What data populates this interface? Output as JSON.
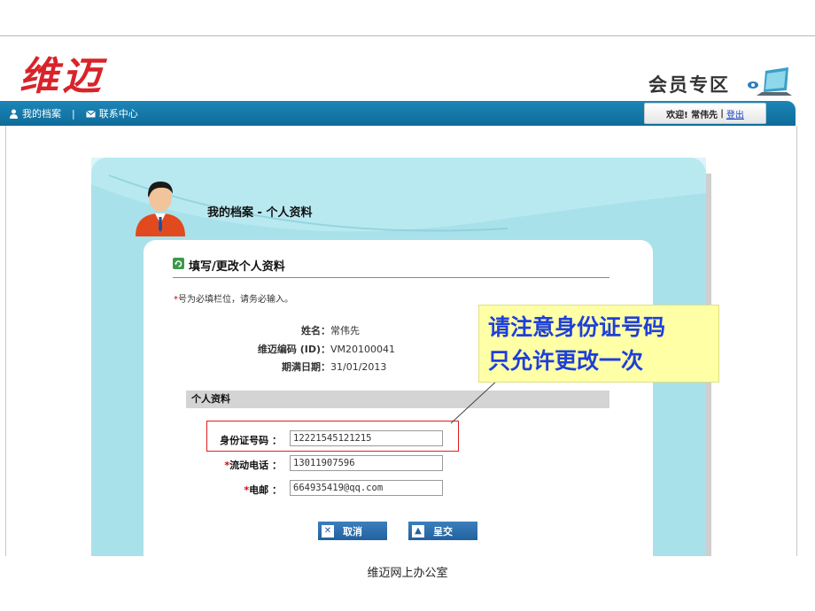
{
  "brand": "维迈",
  "member_zone": "会员专区",
  "nav": {
    "my_profile": "我的档案",
    "separator": "|",
    "contact": "联系中心"
  },
  "welcome": {
    "text": "欢迎! 常伟先",
    "separator": "|",
    "logout": "登出"
  },
  "panel": {
    "title": "我的档案 - 个人资料",
    "form_title": "填写/更改个人资料",
    "required_note_star": "*",
    "required_note": "号为必填栏位，请务必输入。"
  },
  "info": [
    {
      "label": "姓名：",
      "value": "常伟先"
    },
    {
      "label": "维迈编码 (ID)：",
      "value": "VM20100041"
    },
    {
      "label": "期满日期：",
      "value": "31/01/2013"
    }
  ],
  "section_title": "个人资料",
  "fields": {
    "id_number": {
      "label": "身份证号码 ：",
      "value": "12221545121215"
    },
    "mobile": {
      "star": "*",
      "label": "流动电话 ：",
      "value": "13011907596"
    },
    "email": {
      "star": "*",
      "label": "电邮 ：",
      "value": "664935419@qq.com"
    }
  },
  "buttons": {
    "cancel": "取消",
    "submit": "呈交"
  },
  "callout": {
    "line1": "请注意身份证号码",
    "line2": "只允许更改一次"
  },
  "footer": "维迈网上办公室",
  "colors": {
    "brand": "#d8232a",
    "nav": "#1479ab",
    "panel": "#a9e1ea",
    "button": "#2a6eae",
    "callout_bg": "#ffffa6",
    "callout_text": "#1e3fd9",
    "highlight": "#e01e1e"
  }
}
